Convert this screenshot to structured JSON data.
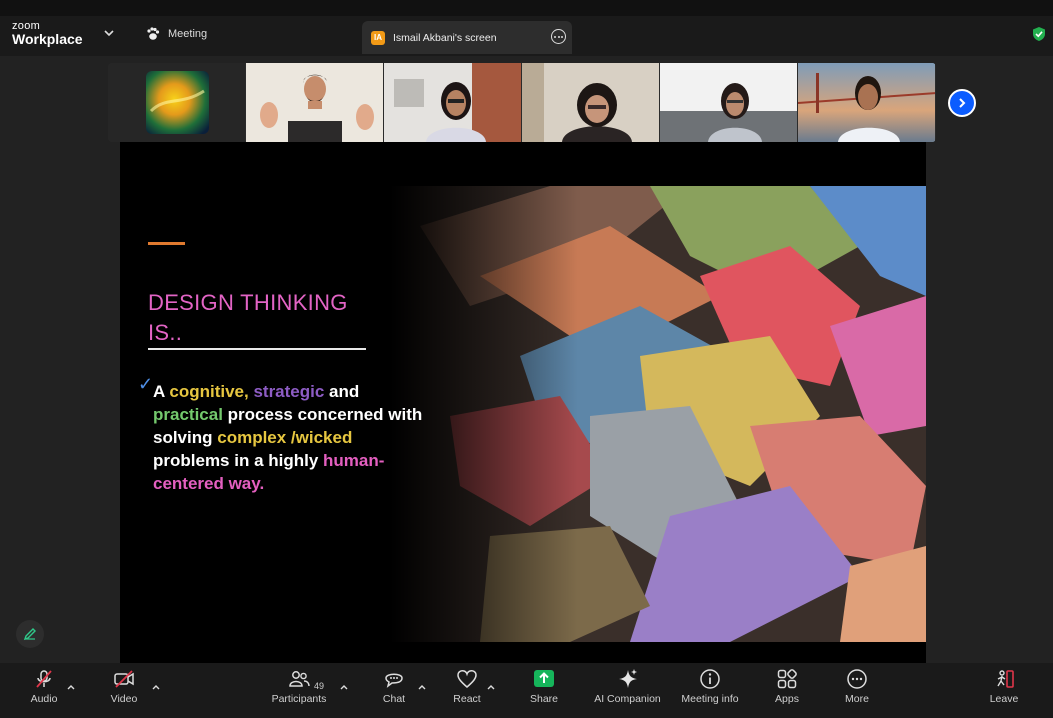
{
  "window": {
    "brand_small": "zoom",
    "brand_name": "Workplace"
  },
  "header": {
    "meeting_label": "Meeting",
    "share_tab": {
      "initials": "IA",
      "label": "Ismail Akbani's screen"
    }
  },
  "icons": {
    "chevron": "chevron-down-icon",
    "paw": "paw-icon",
    "more": "more-options-icon",
    "shield": "shield-check-icon",
    "next": "chevron-right-icon"
  },
  "participants": {
    "tiles": [
      {
        "kind": "avatar-image"
      },
      {
        "kind": "video",
        "active": true
      },
      {
        "kind": "video"
      },
      {
        "kind": "video"
      },
      {
        "kind": "video"
      },
      {
        "kind": "video"
      }
    ]
  },
  "slide": {
    "title_line1": "DESIGN THINKING",
    "title_line2": "IS..",
    "check": "✓",
    "body": {
      "w1": "A ",
      "w2": "cognitive, ",
      "w3": "strategic",
      "w4": " and",
      "w5": "practical",
      "w6": " process concerned with",
      "w7": "solving ",
      "w8": "complex /wicked",
      "w9": "problems in a highly ",
      "w10": "human-",
      "w11": "centered way."
    }
  },
  "toolbar": {
    "audio": "Audio",
    "video": "Video",
    "participants": "Participants",
    "participants_count": "49",
    "chat": "Chat",
    "react": "React",
    "share": "Share",
    "ai": "AI Companion",
    "info": "Meeting info",
    "apps": "Apps",
    "more": "More",
    "leave": "Leave"
  },
  "colors": {
    "accent_green": "#2fc98a",
    "share_green": "#16b55b",
    "brand_blue": "#0b5cff",
    "leave_red": "#e0364a",
    "title_pink": "#e264c5"
  }
}
